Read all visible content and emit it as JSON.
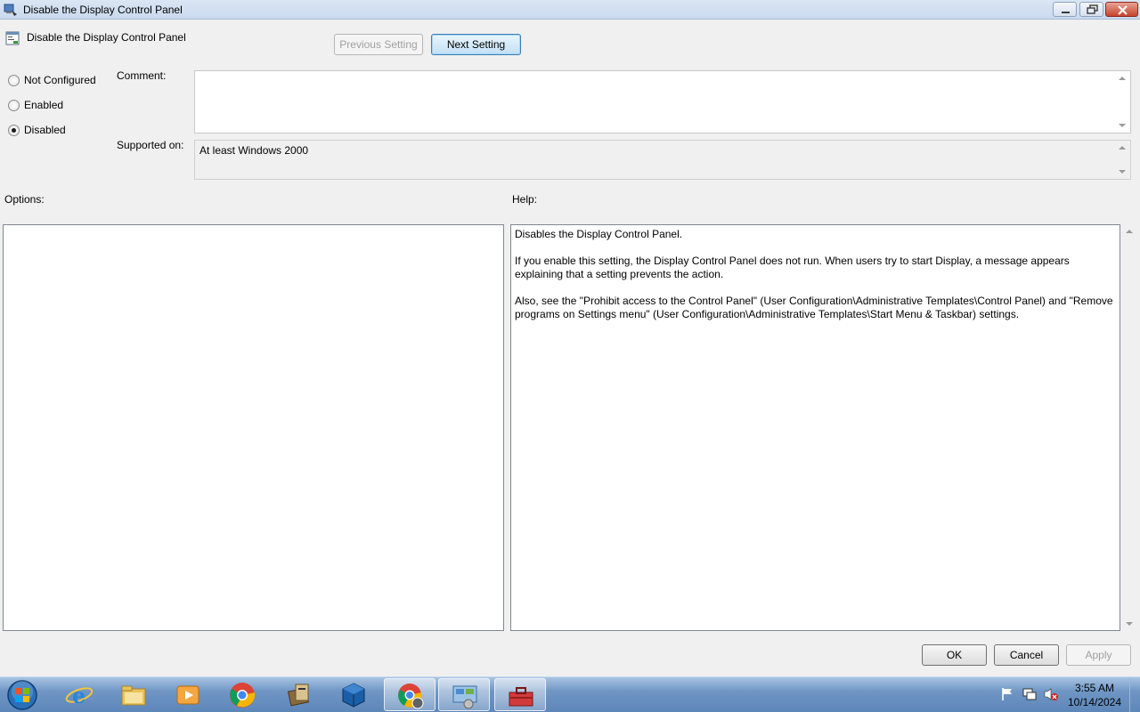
{
  "window": {
    "title": "Disable the Display Control Panel",
    "controls": {
      "minimize": "minimize-icon",
      "maximize": "restore-icon",
      "close": "close-icon"
    }
  },
  "header": {
    "policy_name": "Disable the Display Control Panel",
    "previous_label": "Previous Setting",
    "next_label": "Next Setting"
  },
  "state": {
    "options": [
      {
        "label": "Not Configured",
        "checked": false
      },
      {
        "label": "Enabled",
        "checked": false
      },
      {
        "label": "Disabled",
        "checked": true
      }
    ]
  },
  "comment": {
    "label": "Comment:",
    "value": ""
  },
  "supported": {
    "label": "Supported on:",
    "value": "At least Windows 2000"
  },
  "options_panel": {
    "label": "Options:"
  },
  "help": {
    "label": "Help:",
    "paragraphs": [
      "Disables the Display Control Panel.",
      "If you enable this setting, the Display Control Panel does not run. When users try to start Display, a message appears explaining that a setting prevents the action.",
      "Also, see the \"Prohibit access to the Control Panel\" (User Configuration\\Administrative Templates\\Control Panel) and \"Remove programs on Settings menu\" (User Configuration\\Administrative Templates\\Start Menu & Taskbar) settings."
    ]
  },
  "footer": {
    "ok_label": "OK",
    "cancel_label": "Cancel",
    "apply_label": "Apply"
  },
  "taskbar": {
    "items": [
      "internet-explorer-icon",
      "file-explorer-icon",
      "media-player-icon",
      "chrome-icon",
      "archive-tool-icon",
      "virtualbox-icon",
      "chrome-profile-icon",
      "control-panel-icon",
      "toolbox-icon"
    ],
    "tray": [
      "action-center-flag-icon",
      "network-icon",
      "volume-muted-icon"
    ],
    "time": "3:55 AM",
    "date": "10/14/2024"
  }
}
